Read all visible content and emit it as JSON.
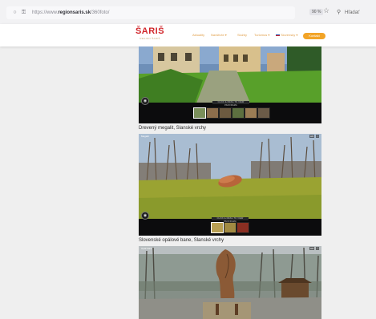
{
  "browser": {
    "url_prefix": "https://www.",
    "url_domain": "regionsaris.sk",
    "url_path": "/360foto/",
    "zoom": "90 %",
    "search_placeholder": "Hľadať"
  },
  "site": {
    "logo_text": "ŠARIŠ",
    "logo_tagline": "REGION ŠARIŠ",
    "nav": [
      {
        "label": "Aktuality"
      },
      {
        "label": "Navštívte ▾"
      },
      {
        "label": "Služby"
      },
      {
        "label": "Turizmus ▾"
      },
      {
        "label": "Slovensky ▾"
      }
    ],
    "cta_label": "Kontakt"
  },
  "panels": [
    {
      "caption": "",
      "strip_label": "CLICK & DRAG TO VIEW PANORAMA"
    },
    {
      "caption": "Drevený megalit, Slanské vrchy",
      "strip_label": "CLICK & DRAG TO VIEW PANORAMA",
      "corner": "Megalit",
      "hd": "HD"
    },
    {
      "caption": "Slovenské opálové bane, Slanské vrchy",
      "corner": "Opál bane",
      "hd": "HD"
    }
  ],
  "icons": {
    "vr": "vr-icon",
    "fullscreen": "fullscreen-icon",
    "lock": "lock-icon",
    "shield": "shield-icon",
    "star": "star-icon",
    "search": "search-icon"
  }
}
